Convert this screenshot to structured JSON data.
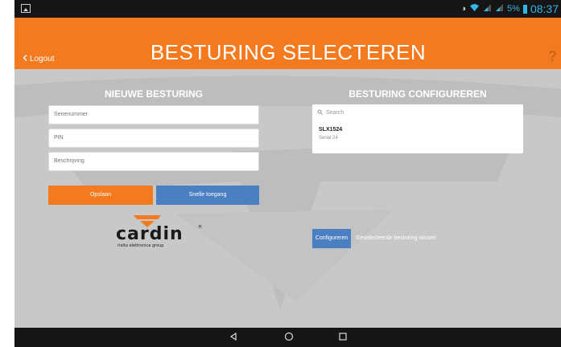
{
  "status_bar": {
    "battery_percent": "5%",
    "time": "08:37"
  },
  "header": {
    "logout_label": "Logout",
    "title": "BESTURING SELECTEREN",
    "help_glyph": "?"
  },
  "new_control": {
    "heading": "NIEUWE BESTURING",
    "fields": {
      "serial_placeholder": "Serienummer",
      "pin_placeholder": "PIN",
      "description_placeholder": "Beschrijving"
    },
    "save_label": "Opslaan",
    "quick_access_label": "Snelle toegang"
  },
  "logo": {
    "brand": "cardin",
    "tagline": "rielta elettronica group"
  },
  "configure_control": {
    "heading": "BESTURING CONFIGUREREN",
    "search_placeholder": "Search",
    "items": [
      {
        "name": "SLX1524",
        "subtitle": "Serial 24"
      }
    ],
    "configure_label": "Configureren",
    "clear_label": "Geselecteerde besturing wissen"
  },
  "colors": {
    "accent_orange": "#f47a20",
    "button_blue": "#4a7fc1",
    "status_blue": "#33b5e5"
  }
}
